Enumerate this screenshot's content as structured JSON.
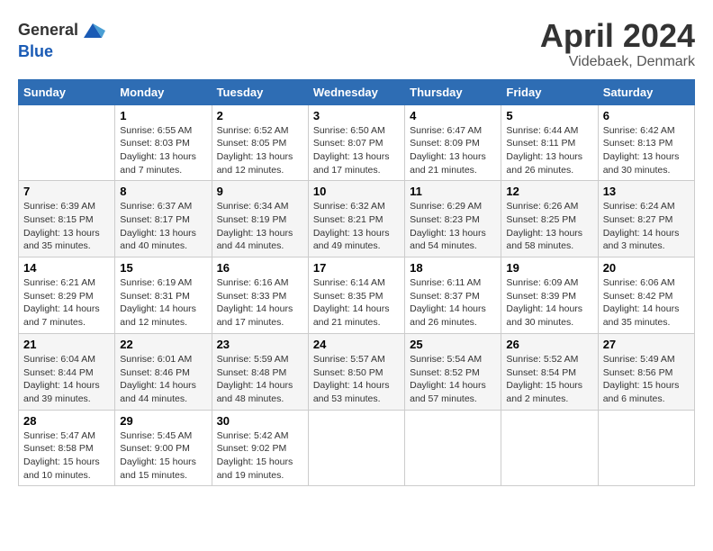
{
  "header": {
    "logo_line1": "General",
    "logo_line2": "Blue",
    "title": "April 2024",
    "location": "Videbaek, Denmark"
  },
  "weekdays": [
    "Sunday",
    "Monday",
    "Tuesday",
    "Wednesday",
    "Thursday",
    "Friday",
    "Saturday"
  ],
  "weeks": [
    [
      {
        "day": "",
        "info": ""
      },
      {
        "day": "1",
        "info": "Sunrise: 6:55 AM\nSunset: 8:03 PM\nDaylight: 13 hours\nand 7 minutes."
      },
      {
        "day": "2",
        "info": "Sunrise: 6:52 AM\nSunset: 8:05 PM\nDaylight: 13 hours\nand 12 minutes."
      },
      {
        "day": "3",
        "info": "Sunrise: 6:50 AM\nSunset: 8:07 PM\nDaylight: 13 hours\nand 17 minutes."
      },
      {
        "day": "4",
        "info": "Sunrise: 6:47 AM\nSunset: 8:09 PM\nDaylight: 13 hours\nand 21 minutes."
      },
      {
        "day": "5",
        "info": "Sunrise: 6:44 AM\nSunset: 8:11 PM\nDaylight: 13 hours\nand 26 minutes."
      },
      {
        "day": "6",
        "info": "Sunrise: 6:42 AM\nSunset: 8:13 PM\nDaylight: 13 hours\nand 30 minutes."
      }
    ],
    [
      {
        "day": "7",
        "info": "Sunrise: 6:39 AM\nSunset: 8:15 PM\nDaylight: 13 hours\nand 35 minutes."
      },
      {
        "day": "8",
        "info": "Sunrise: 6:37 AM\nSunset: 8:17 PM\nDaylight: 13 hours\nand 40 minutes."
      },
      {
        "day": "9",
        "info": "Sunrise: 6:34 AM\nSunset: 8:19 PM\nDaylight: 13 hours\nand 44 minutes."
      },
      {
        "day": "10",
        "info": "Sunrise: 6:32 AM\nSunset: 8:21 PM\nDaylight: 13 hours\nand 49 minutes."
      },
      {
        "day": "11",
        "info": "Sunrise: 6:29 AM\nSunset: 8:23 PM\nDaylight: 13 hours\nand 54 minutes."
      },
      {
        "day": "12",
        "info": "Sunrise: 6:26 AM\nSunset: 8:25 PM\nDaylight: 13 hours\nand 58 minutes."
      },
      {
        "day": "13",
        "info": "Sunrise: 6:24 AM\nSunset: 8:27 PM\nDaylight: 14 hours\nand 3 minutes."
      }
    ],
    [
      {
        "day": "14",
        "info": "Sunrise: 6:21 AM\nSunset: 8:29 PM\nDaylight: 14 hours\nand 7 minutes."
      },
      {
        "day": "15",
        "info": "Sunrise: 6:19 AM\nSunset: 8:31 PM\nDaylight: 14 hours\nand 12 minutes."
      },
      {
        "day": "16",
        "info": "Sunrise: 6:16 AM\nSunset: 8:33 PM\nDaylight: 14 hours\nand 17 minutes."
      },
      {
        "day": "17",
        "info": "Sunrise: 6:14 AM\nSunset: 8:35 PM\nDaylight: 14 hours\nand 21 minutes."
      },
      {
        "day": "18",
        "info": "Sunrise: 6:11 AM\nSunset: 8:37 PM\nDaylight: 14 hours\nand 26 minutes."
      },
      {
        "day": "19",
        "info": "Sunrise: 6:09 AM\nSunset: 8:39 PM\nDaylight: 14 hours\nand 30 minutes."
      },
      {
        "day": "20",
        "info": "Sunrise: 6:06 AM\nSunset: 8:42 PM\nDaylight: 14 hours\nand 35 minutes."
      }
    ],
    [
      {
        "day": "21",
        "info": "Sunrise: 6:04 AM\nSunset: 8:44 PM\nDaylight: 14 hours\nand 39 minutes."
      },
      {
        "day": "22",
        "info": "Sunrise: 6:01 AM\nSunset: 8:46 PM\nDaylight: 14 hours\nand 44 minutes."
      },
      {
        "day": "23",
        "info": "Sunrise: 5:59 AM\nSunset: 8:48 PM\nDaylight: 14 hours\nand 48 minutes."
      },
      {
        "day": "24",
        "info": "Sunrise: 5:57 AM\nSunset: 8:50 PM\nDaylight: 14 hours\nand 53 minutes."
      },
      {
        "day": "25",
        "info": "Sunrise: 5:54 AM\nSunset: 8:52 PM\nDaylight: 14 hours\nand 57 minutes."
      },
      {
        "day": "26",
        "info": "Sunrise: 5:52 AM\nSunset: 8:54 PM\nDaylight: 15 hours\nand 2 minutes."
      },
      {
        "day": "27",
        "info": "Sunrise: 5:49 AM\nSunset: 8:56 PM\nDaylight: 15 hours\nand 6 minutes."
      }
    ],
    [
      {
        "day": "28",
        "info": "Sunrise: 5:47 AM\nSunset: 8:58 PM\nDaylight: 15 hours\nand 10 minutes."
      },
      {
        "day": "29",
        "info": "Sunrise: 5:45 AM\nSunset: 9:00 PM\nDaylight: 15 hours\nand 15 minutes."
      },
      {
        "day": "30",
        "info": "Sunrise: 5:42 AM\nSunset: 9:02 PM\nDaylight: 15 hours\nand 19 minutes."
      },
      {
        "day": "",
        "info": ""
      },
      {
        "day": "",
        "info": ""
      },
      {
        "day": "",
        "info": ""
      },
      {
        "day": "",
        "info": ""
      }
    ]
  ]
}
